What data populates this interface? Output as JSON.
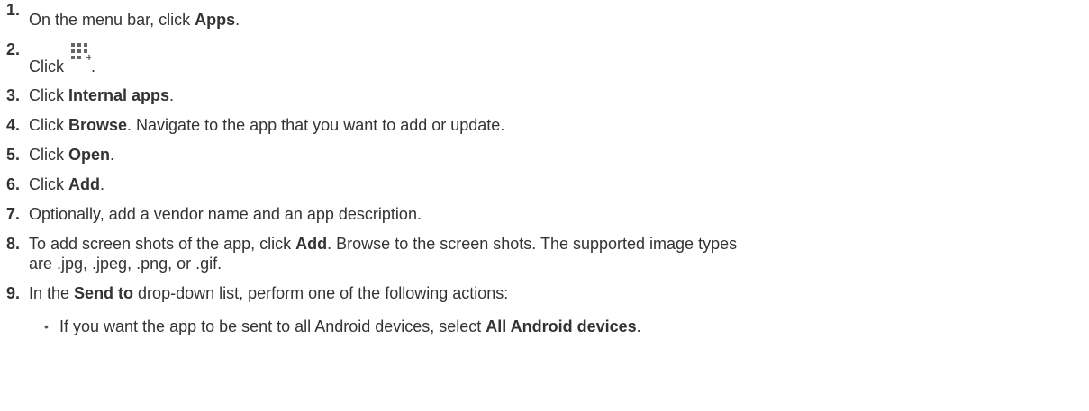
{
  "steps": [
    {
      "num": "1.",
      "parts": [
        "On the menu bar, click ",
        "Apps",
        "."
      ]
    },
    {
      "num": "2.",
      "parts": [
        "Click ",
        "."
      ]
    },
    {
      "num": "3.",
      "parts": [
        "Click ",
        "Internal apps",
        "."
      ]
    },
    {
      "num": "4.",
      "parts": [
        "Click ",
        "Browse",
        ". Navigate to the app that you want to add or update."
      ]
    },
    {
      "num": "5.",
      "parts": [
        "Click ",
        "Open",
        "."
      ]
    },
    {
      "num": "6.",
      "parts": [
        "Click ",
        "Add",
        "."
      ]
    },
    {
      "num": "7.",
      "parts": [
        "Optionally, add a vendor name and an app description."
      ]
    },
    {
      "num": "8.",
      "parts": [
        "To add screen shots of the app, click ",
        "Add",
        ". Browse to the screen shots. The supported image types",
        "are .jpg, .jpeg, .png, or .gif."
      ]
    },
    {
      "num": "9.",
      "parts": [
        "In the ",
        "Send to",
        " drop-down list, perform one of the following actions:"
      ]
    }
  ],
  "substeps": [
    {
      "bullet": "•",
      "parts": [
        "If you want the app to be sent to all Android devices, select ",
        "All Android devices",
        "."
      ]
    }
  ],
  "icons": {
    "step2": "add-apps-grid-icon"
  },
  "colors": {
    "text": "#333333",
    "icon": "#666666"
  }
}
